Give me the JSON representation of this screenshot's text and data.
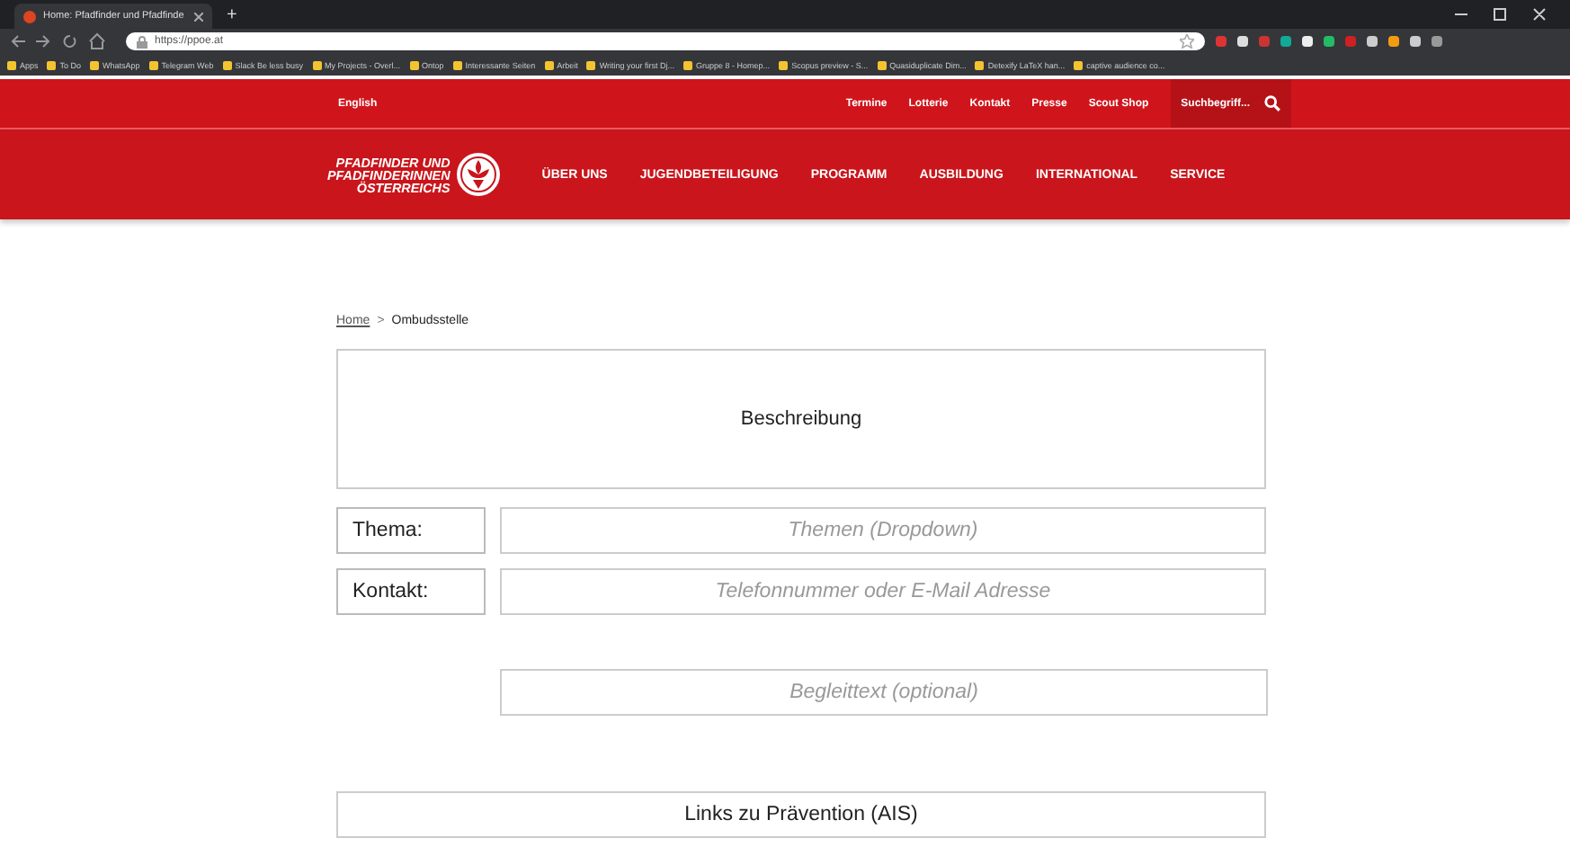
{
  "browser": {
    "tab_title": "Home: Pfadfinder und Pfadfinde",
    "new_tab": "+",
    "url": "https://ppoe.at",
    "bookmarks": [
      "Apps",
      "To Do",
      "WhatsApp",
      "Telegram Web",
      "Slack Be less busy",
      "My Projects - Overl...",
      "Ontop",
      "Interessante Seiten",
      "Arbeit",
      "Writing your first Dj...",
      "Gruppe 8 - Homep...",
      "Scopus preview - S...",
      "Quasiduplicate Dim...",
      "Detexify LaTeX han...",
      "captive audience co..."
    ]
  },
  "site": {
    "language": "English",
    "top_links": [
      "Termine",
      "Lotterie",
      "Kontakt",
      "Presse",
      "Scout Shop"
    ],
    "search": {
      "placeholder": "Suchbegriff..."
    },
    "logo_lines": [
      "PFADFINDER UND",
      "PFADFINDERINNEN",
      "ÖSTERREICHS"
    ],
    "nav": [
      "ÜBER UNS",
      "JUGENDBETEILIGUNG",
      "PROGRAMM",
      "AUSBILDUNG",
      "INTERNATIONAL",
      "SERVICE"
    ]
  },
  "breadcrumb": [
    "Home",
    "Ombudsstelle"
  ],
  "breadcrumb_separator": ">",
  "form": {
    "description": "Beschreibung",
    "fields": [
      {
        "label": "Thema:",
        "placeholder": "Themen (Dropdown)"
      },
      {
        "label": "Kontakt:",
        "placeholder": "Telefonnummer oder E-Mail Adresse"
      }
    ],
    "comment": {
      "placeholder": "Begleittext (optional)"
    },
    "links_box": "Links zu Prävention (AIS)"
  }
}
